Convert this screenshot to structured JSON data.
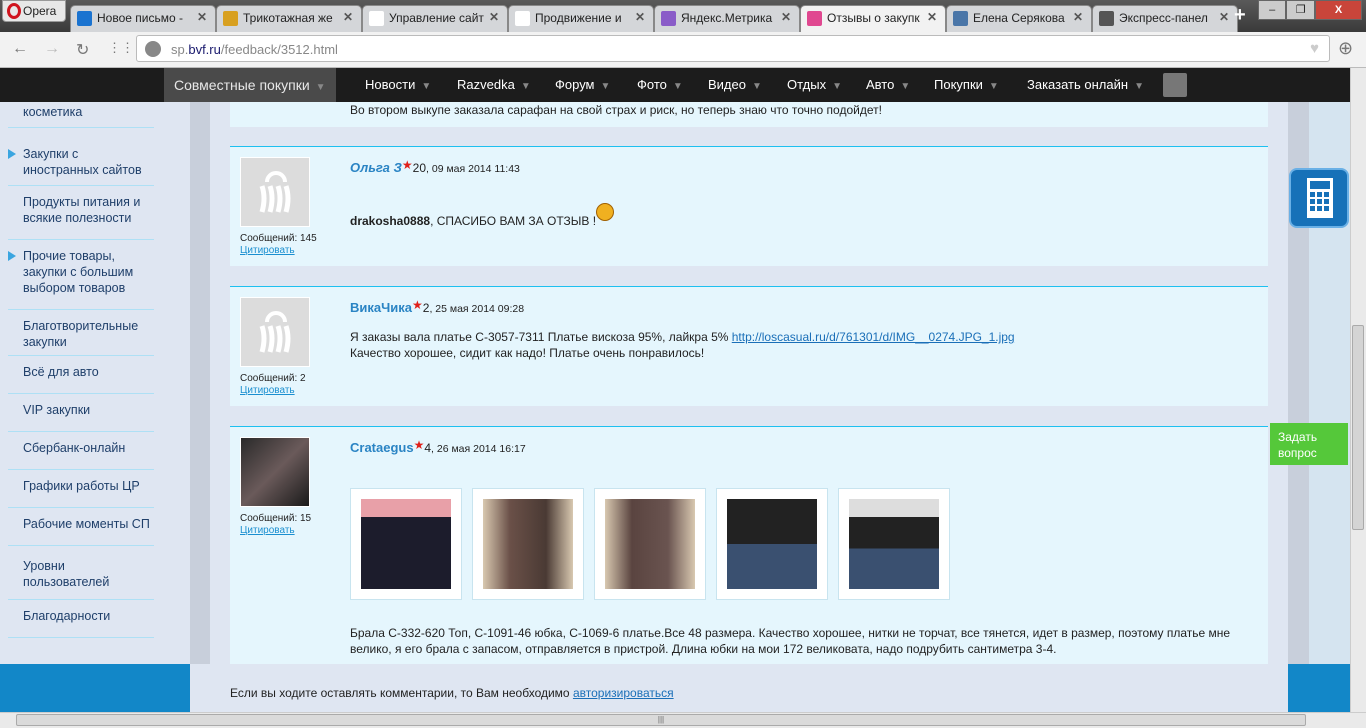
{
  "browser": {
    "opera_label": "Opera",
    "tabs": [
      {
        "label": "Новое письмо -",
        "active": false,
        "color": "#1a73d0"
      },
      {
        "label": "Трикотажная же",
        "active": false,
        "color": "#d8a020"
      },
      {
        "label": "Управление сайт",
        "active": false,
        "color": "#ffffff"
      },
      {
        "label": "Продвижение и",
        "active": false,
        "color": "#ffffff"
      },
      {
        "label": "Яндекс.Метрика",
        "active": false,
        "color": "#8a5cc8"
      },
      {
        "label": "Отзывы о закупк",
        "active": true,
        "color": "#e04890"
      },
      {
        "label": "Елена Серякова",
        "active": false,
        "color": "#4a76a8"
      },
      {
        "label": "Экспресс-панел",
        "active": false,
        "color": "#555555"
      }
    ],
    "url_prefix": "sp.",
    "url_domain": "bvf.ru",
    "url_path": "/feedback/3512.html"
  },
  "nav": {
    "items": [
      "Совместные покупки",
      "Новости",
      "Razvedka",
      "Форум",
      "Фото",
      "Видео",
      "Отдых",
      "Авто",
      "Покупки",
      "Заказать онлайн"
    ]
  },
  "sidebar": {
    "items": [
      {
        "label": "косметика",
        "arrow": false
      },
      {
        "label": "Закупки с иностранных сайтов",
        "arrow": true
      },
      {
        "label": "Продукты питания и всякие полезности",
        "arrow": false
      },
      {
        "label": "Прочие товары, закупки с большим выбором товаров",
        "arrow": true
      },
      {
        "label": "Благотворительные закупки",
        "arrow": false
      },
      {
        "label": "Всё для авто",
        "arrow": false
      },
      {
        "label": "VIP закупки",
        "arrow": false
      },
      {
        "label": "Сбербанк-онлайн",
        "arrow": false
      },
      {
        "label": "Графики работы ЦР",
        "arrow": false
      },
      {
        "label": "Рабочие моменты СП",
        "arrow": false
      },
      {
        "label": "Уровни пользователей",
        "arrow": false
      },
      {
        "label": "Благодарности",
        "arrow": false
      }
    ]
  },
  "prev_post_text": "Во втором выкупе заказала сарафан на свой страх и риск, но теперь знаю что точно подойдет!",
  "posts": [
    {
      "author": "Ольга З",
      "rating": "20",
      "date": ", 09 мая 2014 11:43",
      "messages": "Сообщений: 145",
      "cite": "Цитировать",
      "mention": "drakosha0888",
      "text": ", СПАСИБО ВАМ ЗА ОТЗЫВ !"
    },
    {
      "author": "ВикаЧика",
      "rating": "2",
      "date": ", 25 мая 2014 09:28",
      "messages": "Сообщений: 2",
      "cite": "Цитировать",
      "text1": "Я заказы вала платье С-3057-7311 Платье вискоза 95%, лайкра 5% ",
      "link": "http://loscasual.ru/d/761301/d/IMG__0274.JPG_1.jpg",
      "text2": "Качество хорошее, сидит как надо! Платье очень понравилось!"
    },
    {
      "author": "Crataegus",
      "rating": "4",
      "date": ", 26 мая 2014 16:17",
      "messages": "Сообщений: 15",
      "cite": "Цитировать",
      "text": "Брала С-332-620 Топ, С-1091-46 юбка, С-1069-6 платье.Все 48 размера. Качество хорошее, нитки не торчат, все тянется, идет в размер, поэтому платье мне велико, я его брала с запасом, отправляется в пристрой. Длина юбки на мои 172 великовата, надо подрубить сантиметра 3-4."
    }
  ],
  "comment": {
    "text": "Если вы ходите оставлять комментарии, то Вам необходимо ",
    "link": "авторизироваться"
  },
  "ask_button": "Задать вопрос"
}
